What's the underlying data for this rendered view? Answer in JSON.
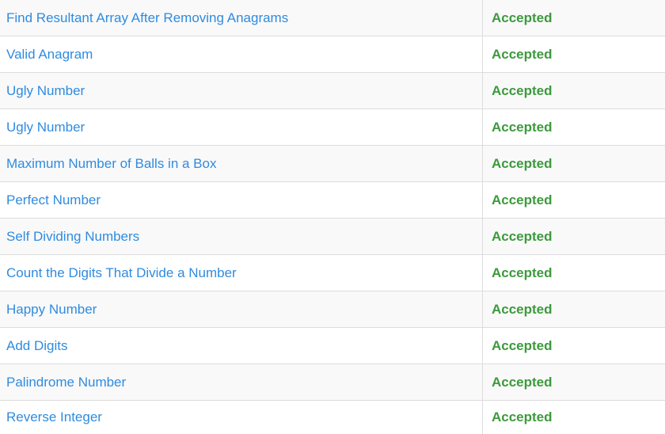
{
  "submissions": [
    {
      "title": "Find Resultant Array After Removing Anagrams",
      "status": "Accepted"
    },
    {
      "title": "Valid Anagram",
      "status": "Accepted"
    },
    {
      "title": "Ugly Number",
      "status": "Accepted"
    },
    {
      "title": "Ugly Number",
      "status": "Accepted"
    },
    {
      "title": "Maximum Number of Balls in a Box",
      "status": "Accepted"
    },
    {
      "title": "Perfect Number",
      "status": "Accepted"
    },
    {
      "title": "Self Dividing Numbers",
      "status": "Accepted"
    },
    {
      "title": "Count the Digits That Divide a Number",
      "status": "Accepted"
    },
    {
      "title": "Happy Number",
      "status": "Accepted"
    },
    {
      "title": "Add Digits",
      "status": "Accepted"
    },
    {
      "title": "Palindrome Number",
      "status": "Accepted"
    },
    {
      "title": "Reverse Integer",
      "status": "Accepted"
    }
  ],
  "colors": {
    "link": "#2f8be0",
    "accepted": "#3c9a3c",
    "row_stripe": "#f9f9f9",
    "border": "#dddddd"
  }
}
